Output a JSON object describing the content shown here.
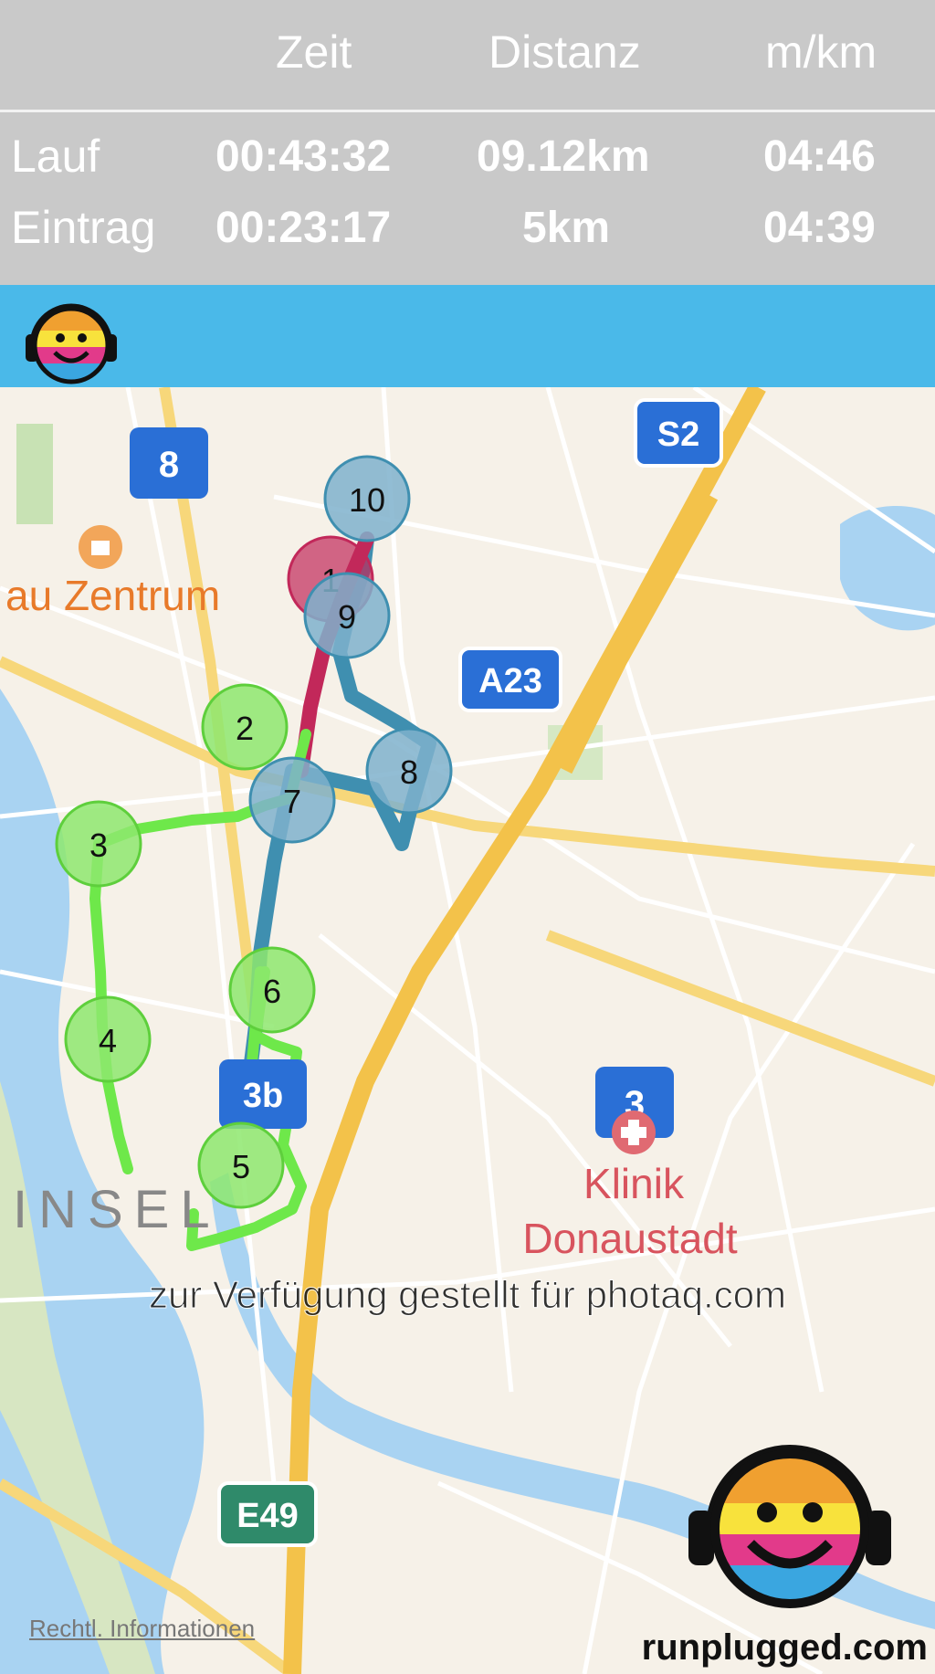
{
  "stats": {
    "headers": {
      "time": "Zeit",
      "distance": "Distanz",
      "pace": "m/km"
    },
    "run": {
      "label": "Lauf",
      "time": "00:43:32",
      "distance": "09.12km",
      "pace": "04:46"
    },
    "entry": {
      "label": "Eintrag",
      "time": "00:23:17",
      "distance": "5km",
      "pace": "04:39"
    }
  },
  "map": {
    "area_labels": {
      "zentrum": "au Zentrum",
      "insel": "INSEL",
      "klinik_line1": "Klinik",
      "klinik_line2": "Donaustadt"
    },
    "road_shields": {
      "s2": "S2",
      "a23": "A23",
      "e49": "E49",
      "line8": "8",
      "line3": "3",
      "line3b": "3b"
    },
    "markers": [
      "1",
      "2",
      "3",
      "4",
      "5",
      "6",
      "7",
      "8",
      "9",
      "10"
    ],
    "legal": "Rechtl. Informationen",
    "watermark": "zur Verfügung gestellt für photaq.com",
    "brand": "runplugged.com",
    "colors": {
      "route_green": "#6ee84a",
      "route_blue": "#3f8fb0",
      "route_red": "#c2285a",
      "header_bar": "#4ab9e9"
    }
  }
}
